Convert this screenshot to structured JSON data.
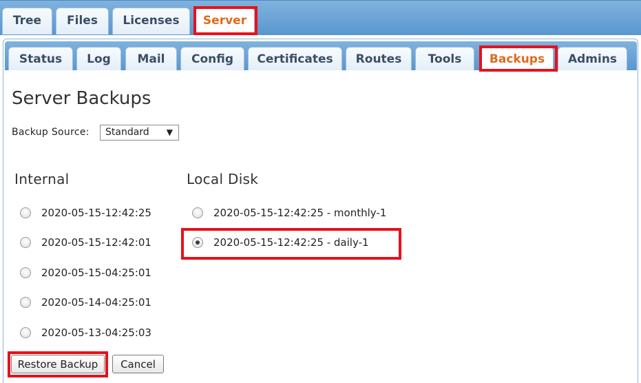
{
  "top_tabs": [
    {
      "label": "Tree",
      "active": false
    },
    {
      "label": "Files",
      "active": false
    },
    {
      "label": "Licenses",
      "active": false
    },
    {
      "label": "Server",
      "active": true
    }
  ],
  "sub_tabs": [
    {
      "label": "Status",
      "active": false
    },
    {
      "label": "Log",
      "active": false
    },
    {
      "label": "Mail",
      "active": false
    },
    {
      "label": "Config",
      "active": false
    },
    {
      "label": "Certificates",
      "active": false
    },
    {
      "label": "Routes",
      "active": false
    },
    {
      "label": "Tools",
      "active": false
    },
    {
      "label": "Backups",
      "active": true
    },
    {
      "label": "Admins",
      "active": false
    }
  ],
  "page": {
    "title": "Server Backups",
    "backup_source_label": "Backup Source:",
    "backup_source_value": "Standard",
    "dropdown_arrow": "▼"
  },
  "internal": {
    "heading": "Internal",
    "items": [
      {
        "label": "2020-05-15-12:42:25",
        "checked": false
      },
      {
        "label": "2020-05-15-12:42:01",
        "checked": false
      },
      {
        "label": "2020-05-15-04:25:01",
        "checked": false
      },
      {
        "label": "2020-05-14-04:25:01",
        "checked": false
      },
      {
        "label": "2020-05-13-04:25:03",
        "checked": false
      }
    ]
  },
  "local_disk": {
    "heading": "Local Disk",
    "items": [
      {
        "label": "2020-05-15-12:42:25 - monthly-1",
        "checked": false
      },
      {
        "label": "2020-05-15-12:42:25 - daily-1",
        "checked": true
      }
    ]
  },
  "buttons": {
    "restore": "Restore Backup",
    "cancel": "Cancel"
  },
  "colors": {
    "highlight": "#e8101a",
    "active_tab_text": "#e06a1b",
    "tab_bar": "#6aa4d8"
  }
}
